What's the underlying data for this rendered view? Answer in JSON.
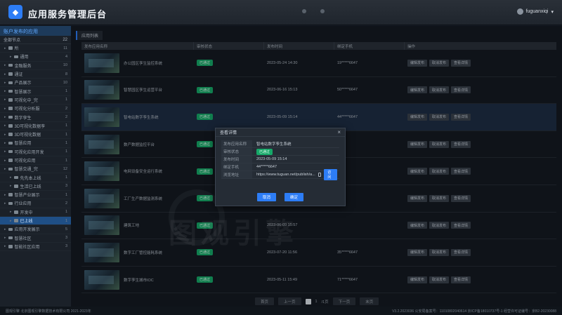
{
  "header": {
    "title": "应用服务管理后台",
    "logo_glyph": "◆",
    "user": "fuguanxiqi"
  },
  "sidebar": {
    "title": "账户发布的应用",
    "sub": {
      "label": "全部节点",
      "count": "22"
    },
    "items": [
      {
        "label": "所",
        "count": "11",
        "level": 0
      },
      {
        "label": "通用",
        "count": "4",
        "level": 1
      },
      {
        "label": "金融服务",
        "count": "10",
        "level": 0
      },
      {
        "label": "通证",
        "count": "8",
        "level": 0
      },
      {
        "label": "产品展示",
        "count": "10",
        "level": 0
      },
      {
        "label": "智慧展示",
        "count": "1",
        "level": 0
      },
      {
        "label": "可视化中_完",
        "count": "1",
        "level": 0
      },
      {
        "label": "可视化分析服",
        "count": "2",
        "level": 0
      },
      {
        "label": "数字孪生",
        "count": "2",
        "level": 0
      },
      {
        "label": "3D可视化数据孪",
        "count": "1",
        "level": 0
      },
      {
        "label": "3D可视化数据",
        "count": "1",
        "level": 0
      },
      {
        "label": "智慧应用",
        "count": "1",
        "level": 0
      },
      {
        "label": "可视化应用开发",
        "count": "1",
        "level": 0
      },
      {
        "label": "可视化应用",
        "count": "1",
        "level": 0
      },
      {
        "label": "智慧交通_完",
        "count": "12",
        "level": 0
      },
      {
        "label": "先先本上线",
        "count": "1",
        "level": 1
      },
      {
        "label": "生活已上线",
        "count": "3",
        "level": 1
      },
      {
        "label": "智慧产业展示",
        "count": "1",
        "level": 0
      },
      {
        "label": "行业应用",
        "count": "2",
        "level": 0
      },
      {
        "label": "开发中",
        "count": "1",
        "level": 1
      },
      {
        "label": "已上线",
        "count": "1",
        "level": 1,
        "selected": true
      },
      {
        "label": "应用开发展示",
        "count": "5",
        "level": 0
      },
      {
        "label": "智慧社区",
        "count": "3",
        "level": 0
      },
      {
        "label": "智能社区应用",
        "count": "3",
        "level": 0
      }
    ]
  },
  "main": {
    "breadcrumb": "应用列表",
    "columns": [
      "发布应用名称",
      "审核状态",
      "发布时间",
      "绑定手机",
      "操作"
    ],
    "rows": [
      {
        "name": "办公园区孪生监控系统",
        "status": "已通过",
        "time": "2023-05-24 14:30",
        "phone": "19*****6647",
        "ops": [
          "编辑发布",
          "取消发布",
          "查看详情"
        ],
        "highlight": false
      },
      {
        "name": "智慧园区孪生运营平台",
        "status": "已通过",
        "time": "2023-06-16 15:13",
        "phone": "50*****6647",
        "ops": [
          "编辑发布",
          "取消发布",
          "查看详情"
        ],
        "highlight": false
      },
      {
        "name": "智电站数字孪生系统",
        "status": "已通过",
        "time": "2023-05-09 15:14",
        "phone": "44*****6647",
        "ops": [
          "编辑发布",
          "取消发布",
          "查看详情"
        ],
        "highlight": true
      },
      {
        "name": "数产数据监控平台",
        "status": "已通过",
        "time": "",
        "phone": "",
        "ops": [
          "编辑发布",
          "取消发布",
          "查看详情"
        ],
        "highlight": false
      },
      {
        "name": "电网设备安全运行系统",
        "status": "已通过",
        "time": "",
        "phone": "",
        "ops": [
          "编辑发布",
          "取消发布",
          "查看详情"
        ],
        "highlight": false
      },
      {
        "name": "工厂生产数据监测系统",
        "status": "已通过",
        "time": "",
        "phone": "",
        "ops": [
          "编辑发布",
          "取消发布",
          "查看详情"
        ],
        "highlight": false
      },
      {
        "name": "建筑工地",
        "status": "已通过",
        "time": "2023-06-09 15:57",
        "phone": "",
        "ops": [
          "编辑发布",
          "取消发布",
          "查看详情"
        ],
        "highlight": false
      },
      {
        "name": "数字工厂管控能耗系统",
        "status": "已通过",
        "time": "2023-07-20 11:56",
        "phone": "35*****6647",
        "ops": [
          "编辑发布",
          "取消发布",
          "查看详情"
        ],
        "highlight": false
      },
      {
        "name": "数字孪生城市IOC",
        "status": "已通过",
        "time": "2023-05-11 15:49",
        "phone": "71*****6647",
        "ops": [
          "编辑发布",
          "取消发布",
          "查看详情"
        ],
        "highlight": false
      }
    ]
  },
  "pager": {
    "first": "首页",
    "prev": "上一页",
    "page": "1",
    "total": "/1页",
    "next": "下一页",
    "last": "末页"
  },
  "footer": {
    "left": "图观引擎 北京图观引擎数据技术有限公司 2021-2023年",
    "right": "V3.2.2023036 公安局备案号：11010802040614 京ICP备18010737号-1 经营许可证编号：京B2-20230088"
  },
  "modal": {
    "title": "查看详情",
    "fields": [
      {
        "label": "发布应用名称",
        "value": "智电站数字孪生系统"
      },
      {
        "label": "审核状态",
        "value": "已通过"
      },
      {
        "label": "发布时间",
        "value": "2023-05-09 15:14"
      },
      {
        "label": "绑定手机",
        "value": "44*****6647"
      },
      {
        "label": "浏览地址",
        "value": "https://www.tuguan.net/publish/a..."
      }
    ],
    "open_btn": "访问",
    "cancel_btn": "取消",
    "ok_btn": "确定"
  },
  "watermark": "图观引擎",
  "colors": {
    "accent": "#2d7df6",
    "success": "#16a868",
    "bg": "#141a22"
  }
}
